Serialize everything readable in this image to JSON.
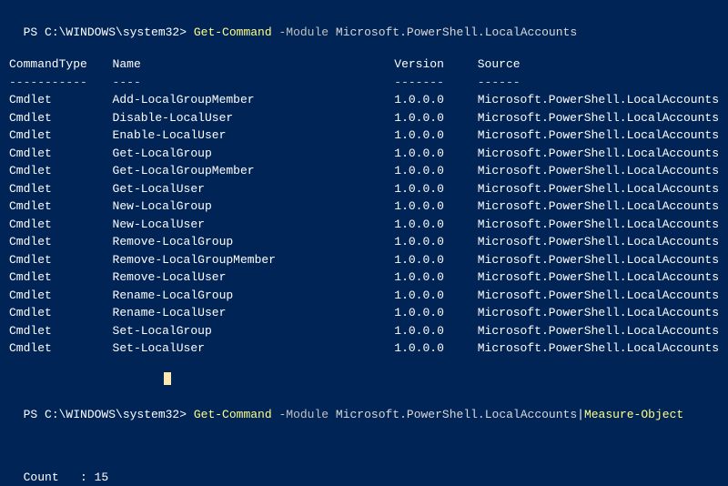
{
  "line1": {
    "prompt": "PS C:\\WINDOWS\\system32> ",
    "cmd": "Get-Command",
    "param": " -Module ",
    "arg": "Microsoft.PowerShell.LocalAccounts"
  },
  "headers": {
    "type": "CommandType",
    "name": "Name",
    "version": "Version",
    "source": "Source"
  },
  "underlines": {
    "type": "-----------",
    "name": "----",
    "version": "-------",
    "source": "------"
  },
  "rows": [
    {
      "type": "Cmdlet",
      "name": "Add-LocalGroupMember",
      "version": "1.0.0.0",
      "source": "Microsoft.PowerShell.LocalAccounts"
    },
    {
      "type": "Cmdlet",
      "name": "Disable-LocalUser",
      "version": "1.0.0.0",
      "source": "Microsoft.PowerShell.LocalAccounts"
    },
    {
      "type": "Cmdlet",
      "name": "Enable-LocalUser",
      "version": "1.0.0.0",
      "source": "Microsoft.PowerShell.LocalAccounts"
    },
    {
      "type": "Cmdlet",
      "name": "Get-LocalGroup",
      "version": "1.0.0.0",
      "source": "Microsoft.PowerShell.LocalAccounts"
    },
    {
      "type": "Cmdlet",
      "name": "Get-LocalGroupMember",
      "version": "1.0.0.0",
      "source": "Microsoft.PowerShell.LocalAccounts"
    },
    {
      "type": "Cmdlet",
      "name": "Get-LocalUser",
      "version": "1.0.0.0",
      "source": "Microsoft.PowerShell.LocalAccounts"
    },
    {
      "type": "Cmdlet",
      "name": "New-LocalGroup",
      "version": "1.0.0.0",
      "source": "Microsoft.PowerShell.LocalAccounts"
    },
    {
      "type": "Cmdlet",
      "name": "New-LocalUser",
      "version": "1.0.0.0",
      "source": "Microsoft.PowerShell.LocalAccounts"
    },
    {
      "type": "Cmdlet",
      "name": "Remove-LocalGroup",
      "version": "1.0.0.0",
      "source": "Microsoft.PowerShell.LocalAccounts"
    },
    {
      "type": "Cmdlet",
      "name": "Remove-LocalGroupMember",
      "version": "1.0.0.0",
      "source": "Microsoft.PowerShell.LocalAccounts"
    },
    {
      "type": "Cmdlet",
      "name": "Remove-LocalUser",
      "version": "1.0.0.0",
      "source": "Microsoft.PowerShell.LocalAccounts"
    },
    {
      "type": "Cmdlet",
      "name": "Rename-LocalGroup",
      "version": "1.0.0.0",
      "source": "Microsoft.PowerShell.LocalAccounts"
    },
    {
      "type": "Cmdlet",
      "name": "Rename-LocalUser",
      "version": "1.0.0.0",
      "source": "Microsoft.PowerShell.LocalAccounts"
    },
    {
      "type": "Cmdlet",
      "name": "Set-LocalGroup",
      "version": "1.0.0.0",
      "source": "Microsoft.PowerShell.LocalAccounts"
    },
    {
      "type": "Cmdlet",
      "name": "Set-LocalUser",
      "version": "1.0.0.0",
      "source": "Microsoft.PowerShell.LocalAccounts"
    }
  ],
  "line2": {
    "prompt": "PS C:\\WINDOWS\\system32> ",
    "cmd": "Get-Command",
    "param": " -Module ",
    "arg": "Microsoft.PowerShell.LocalAccounts",
    "pipe": "|",
    "cmd2": "Measure-Object"
  },
  "result": {
    "count_label": "Count   : ",
    "count_value": "15"
  }
}
